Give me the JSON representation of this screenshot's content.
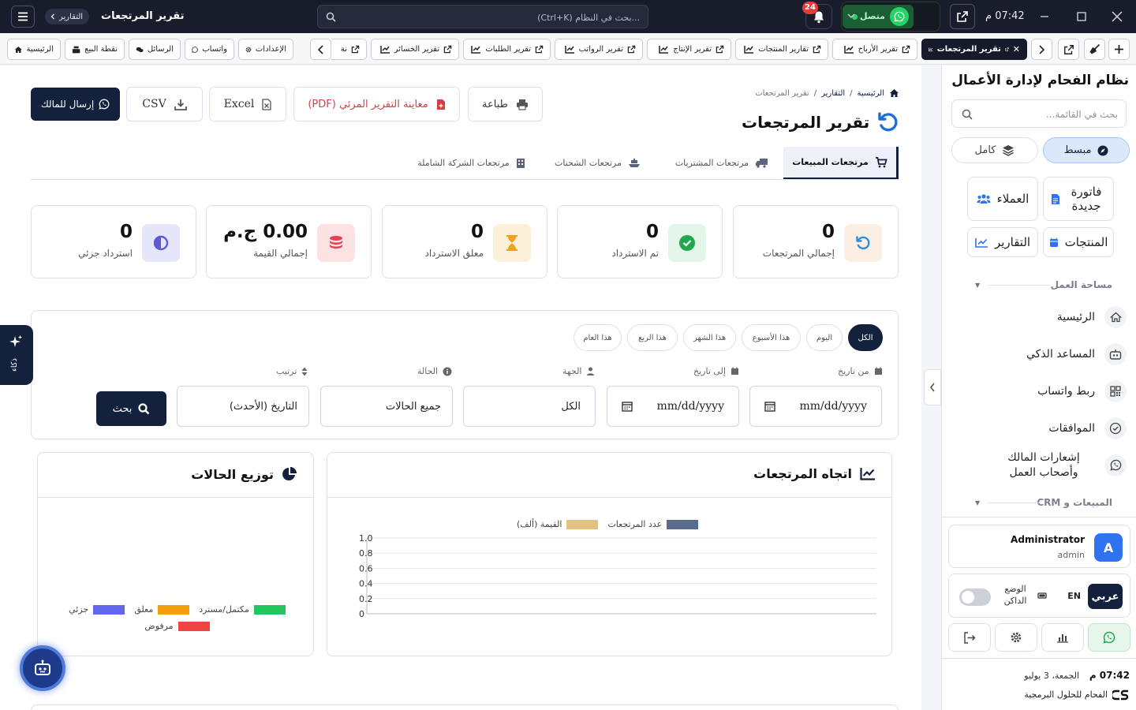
{
  "topbar": {
    "time": "07:42 م",
    "whatsapp_status": "متصل",
    "notifications_count": "24",
    "search_placeholder": "...بحث في النظام (Ctrl+K)",
    "page_name": "تقرير المرتجعات",
    "crumb_pill": "التقارير"
  },
  "tabs": [
    {
      "label": "الرئيسية",
      "icon": "home-icon"
    },
    {
      "label": "نقطة البيع",
      "icon": "cash-register-icon"
    },
    {
      "label": "الرسائل",
      "icon": "comments-icon"
    },
    {
      "label": "واتساب",
      "icon": "whatsapp-icon"
    },
    {
      "label": "الإعدادات",
      "icon": "gear-icon"
    },
    {
      "label": "نة",
      "icon": "external-link-icon"
    },
    {
      "label": "تقرير الخسائر",
      "icon": "chart-line-icon"
    },
    {
      "label": "تقرير الطلبات",
      "icon": "chart-line-icon"
    },
    {
      "label": "تقرير الرواتب",
      "icon": "chart-line-icon"
    },
    {
      "label": "تقرير الإنتاج",
      "icon": "chart-line-icon"
    },
    {
      "label": "تقارير المنتجات",
      "icon": "chart-line-icon"
    },
    {
      "label": "تقرير الأرباح",
      "icon": "chart-line-icon"
    },
    {
      "label": "تقرير المرتجعات",
      "icon": "chart-line-icon",
      "active": true
    }
  ],
  "sidebar": {
    "title": "نظام الفحام لإدارة الأعمال",
    "search_placeholder": "بحث في القائمة...",
    "modes": {
      "simple": "مبسط",
      "full": "كامل"
    },
    "quick": {
      "new_invoice": "فاتورة جديدة",
      "customers": "العملاء",
      "products": "المنتجات",
      "reports": "التقارير"
    },
    "section_workspace": "مساحة العمل",
    "items": [
      {
        "label": "الرئيسية",
        "icon": "home-icon"
      },
      {
        "label": "المساعد الذكي",
        "icon": "robot-icon"
      },
      {
        "label": "ربط واتساب",
        "icon": "qrcode-icon"
      },
      {
        "label": "الموافقات",
        "icon": "check-circle-icon"
      },
      {
        "label": "إشعارات المالك وأصحاب العمل",
        "icon": "whatsapp-icon"
      }
    ],
    "section_sales": "المبيعات و CRM",
    "user": {
      "name": "Administrator",
      "role": "admin",
      "initial": "A"
    },
    "lang": {
      "arabic": "عربي",
      "english": "EN",
      "dark_mode": "الوضع الداكن"
    },
    "date_time": "07:42 م",
    "date": "الجمعة، 3 يوليو",
    "company": "الفحام للحلول البرمجية"
  },
  "breadcrumb": {
    "home": "الرئيسية",
    "reports": "التقارير",
    "current": "تقرير المرتجعات"
  },
  "page_title": "تقرير المرتجعات",
  "actions": {
    "whatsapp": "إرسال للمالك",
    "csv": "CSV",
    "excel": "Excel",
    "pdf": "معاينة التقرير المرئي (PDF)",
    "print": "طباعة"
  },
  "subtabs": [
    {
      "label": "مرتجعات المبيعات",
      "icon": "cart-icon",
      "active": true
    },
    {
      "label": "مرتجعات المشتريات",
      "icon": "truck-icon"
    },
    {
      "label": "مرتجعات الشحنات",
      "icon": "ship-icon"
    },
    {
      "label": "مرتجعات الشركة الشاملة",
      "icon": "building-icon"
    }
  ],
  "stats": [
    {
      "value": "0",
      "label": "إجمالي المرتجعات",
      "icon": "undo-icon",
      "bg": "#fbeee2",
      "color": "#2f8fd8"
    },
    {
      "value": "0",
      "label": "تم الاسترداد",
      "icon": "check-icon",
      "bg": "#e3f5e9",
      "color": "#1fa84f"
    },
    {
      "value": "0",
      "label": "معلق الاسترداد",
      "icon": "hourglass-icon",
      "bg": "#fdf0d9",
      "color": "#f0a020"
    },
    {
      "value": "0.00 ج.م",
      "label": "إجمالي القيمة",
      "icon": "coins-icon",
      "bg": "#fde2e4",
      "color": "#e64052"
    },
    {
      "value": "0",
      "label": "استرداد جزئي",
      "icon": "half-circle-icon",
      "bg": "#e6e6fb",
      "color": "#5b5bd6"
    }
  ],
  "filters": {
    "chips": [
      "الكل",
      "اليوم",
      "هذا الأسبوع",
      "هذا الشهر",
      "هذا الربع",
      "هذا العام"
    ],
    "from_label": "من تاريخ",
    "to_label": "إلى تاريخ",
    "party_label": "الجهة",
    "status_label": "الحالة",
    "sort_label": "ترتيب",
    "from_value": "mm/dd/yyyy",
    "to_value": "mm/dd/yyyy",
    "party_value": "الكل",
    "status_value": "جميع الحالات",
    "sort_value": "التاريخ (الأحدث)",
    "search_button": "بحث"
  },
  "trend_card": {
    "title": "اتجاه المرتجعات"
  },
  "status_card": {
    "title": "توزيع الحالات"
  },
  "chart_data": [
    {
      "type": "bar",
      "series": [
        {
          "name": "عدد المرتجعات",
          "color": "#5a6c8c",
          "values": []
        },
        {
          "name": "القيمة (ألف)",
          "color": "#e2c283",
          "values": []
        }
      ],
      "categories": [],
      "y_ticks": [
        "0",
        "0.2",
        "0.4",
        "0.6",
        "0.8",
        "1.0"
      ],
      "ylim": [
        0,
        1
      ],
      "grid": true,
      "legend": "top"
    },
    {
      "type": "pie",
      "labels": [
        "مكتمل/مسترد",
        "معلق",
        "جزئي",
        "مرفوض"
      ],
      "colors": [
        "#22c55e",
        "#f59e0b",
        "#6366f1",
        "#ef4444"
      ],
      "values": [],
      "legend": "bottom"
    }
  ],
  "ai_tab": "ذكاء",
  "colors": {
    "dark": "#14213d",
    "topbar": "#181c2b",
    "whatsapp": "#25d366"
  }
}
